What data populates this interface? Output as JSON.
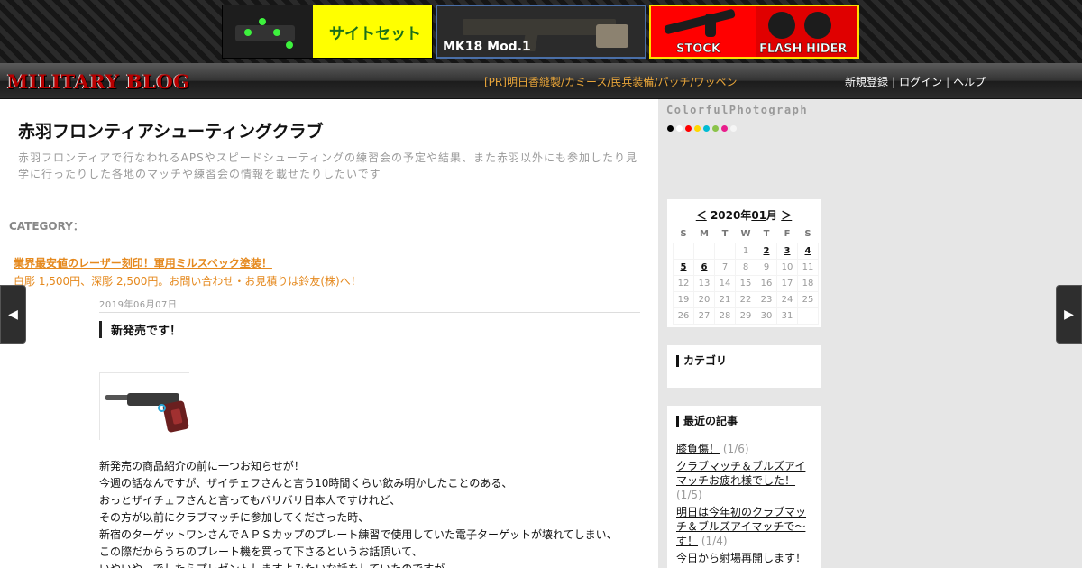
{
  "ads": {
    "sight_set": "サイトセット",
    "mk18": "MK18 Mod.1",
    "stock": "STOCK",
    "flash_hider": "FLASH HIDER"
  },
  "nav": {
    "logo": "MILITARY BLOG",
    "pr_prefix": "[PR]",
    "pr_text": "明日香縫製/カミース/民兵装備/パッチ/ワッペン",
    "register": "新規登録",
    "login": "ログイン",
    "help": "ヘルプ"
  },
  "blog": {
    "title": "赤羽フロンティアシューティングクラブ",
    "description": "赤羽フロンティアで行なわれるAPSやスピードシューティングの練習会の予定や結果、また赤羽以外にも参加したり見学に行ったりした各地のマッチや練習会の情報を載せたりしたいです",
    "category_label": "CATEGORY："
  },
  "ad_link": {
    "title": "業界最安値のレーザー刻印！軍用ミルスペック塗装！",
    "sub": "白彫 1,500円、深彫 2,500円。お問い合わせ・お見積りは鈴友(株)へ！"
  },
  "post": {
    "date": "2019年06月07日",
    "title": "新発売です！",
    "lines": [
      "新発売の商品紹介の前に一つお知らせが！",
      "今週の話なんですが、ザイチェフさんと言う10時間くらい飲み明かしたことのある、",
      "おっとザイチェフさんと言ってもバリバリ日本人ですけれど、",
      "その方が以前にクラブマッチに参加してくださった時、",
      "新宿のターゲットワンさんでＡＰＳカップのプレート練習で使用していた電子ターゲットが壊れてしまい、",
      "この際だからうちのプレート機を買って下さるというお話頂いて、",
      "いやいや、でしたらプレゼントしますよみたいな話をしていたのですが"
    ]
  },
  "nav_arrows": {
    "prev": "◀",
    "next": "▶"
  },
  "sidebar": {
    "theme_name": "ColorfulPhotograph",
    "swatch_colors": [
      "#000000",
      "#ffffff",
      "#ff0000",
      "#ffd700",
      "#00bcd4",
      "#8bc34a",
      "#e91e8c",
      "#f5f5f5"
    ],
    "calendar": {
      "prev": "＜",
      "year_prefix": "2020年",
      "month": "01",
      "month_suffix": "月",
      "next": "＞",
      "dow": [
        "S",
        "M",
        "T",
        "W",
        "T",
        "F",
        "S"
      ],
      "weeks": [
        [
          "",
          "",
          "",
          "1",
          "2",
          "3",
          "4"
        ],
        [
          "5",
          "6",
          "7",
          "8",
          "9",
          "10",
          "11"
        ],
        [
          "12",
          "13",
          "14",
          "15",
          "16",
          "17",
          "18"
        ],
        [
          "19",
          "20",
          "21",
          "22",
          "23",
          "24",
          "25"
        ],
        [
          "26",
          "27",
          "28",
          "29",
          "30",
          "31",
          ""
        ]
      ],
      "linked_days": [
        "2",
        "3",
        "4",
        "5",
        "6"
      ]
    },
    "category_title": "カテゴリ",
    "recent_title": "最近の記事",
    "recent": [
      {
        "title": "膝負傷！",
        "date": "(1/6)"
      },
      {
        "title": "クラブマッチ＆ブルズアイマッチお疲れ様でした！",
        "date": "(1/5)"
      },
      {
        "title": "明日は今年初のクラブマッチ＆ブルズアイマッチで～す！",
        "date": "(1/4)"
      },
      {
        "title": "今日から射場再開します！",
        "date": ""
      }
    ]
  }
}
